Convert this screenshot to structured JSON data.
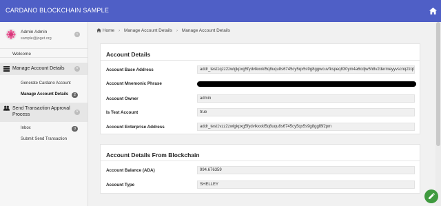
{
  "app": {
    "title": "CARDANO BLOCKCHAIN SAMPLE"
  },
  "user": {
    "name": "Admin Admin",
    "email": "sample@joget.org"
  },
  "sidebar": {
    "welcome": "Welcome",
    "groups": [
      {
        "label": "Manage Account Details",
        "items": [
          {
            "label": "Generate Cardano Account"
          },
          {
            "label": "Manage Account Details",
            "badge": "2"
          }
        ]
      },
      {
        "label": "Send Transaction Approval Process",
        "items": [
          {
            "label": "Inbox",
            "badge": "0"
          },
          {
            "label": "Submit Send Transaction"
          }
        ]
      }
    ]
  },
  "breadcrumb": [
    "Home",
    "Manage Account Details",
    "Manage Account Details"
  ],
  "account_details": {
    "title": "Account Details",
    "fields": [
      {
        "label": "Account Base Address",
        "value": "addr_test1qzz2zwlgkpxg5fydvlkxxkl5q8uqu8s6745cy5qx5s9g8ggwcuvfkspeq830ym4a6cdjw5h8v2dermeyyvscnq2zqtpx"
      },
      {
        "label": "Account Mnemonic Phrase",
        "value": ""
      },
      {
        "label": "Account Owner",
        "value": "admin"
      },
      {
        "label": "Is Test Account",
        "value": "true"
      },
      {
        "label": "Account Enterprise Address",
        "value": "addr_test1vzz2zwlgkpxg5fydvlkxxkl5q8uqu8s6745cy5qx5s9g8ggf8f2pm"
      }
    ]
  },
  "blockchain_details": {
    "title": "Account Details From Blockchain",
    "fields": [
      {
        "label": "Account Balance (ADA)",
        "value": "994.676359"
      },
      {
        "label": "Account Type",
        "value": "SHELLEY"
      }
    ]
  },
  "colors": {
    "header": "#4f5fc6",
    "fab": "#3f9a3f"
  },
  "icons": {
    "home": "home-icon",
    "fab": "pencil-icon"
  }
}
